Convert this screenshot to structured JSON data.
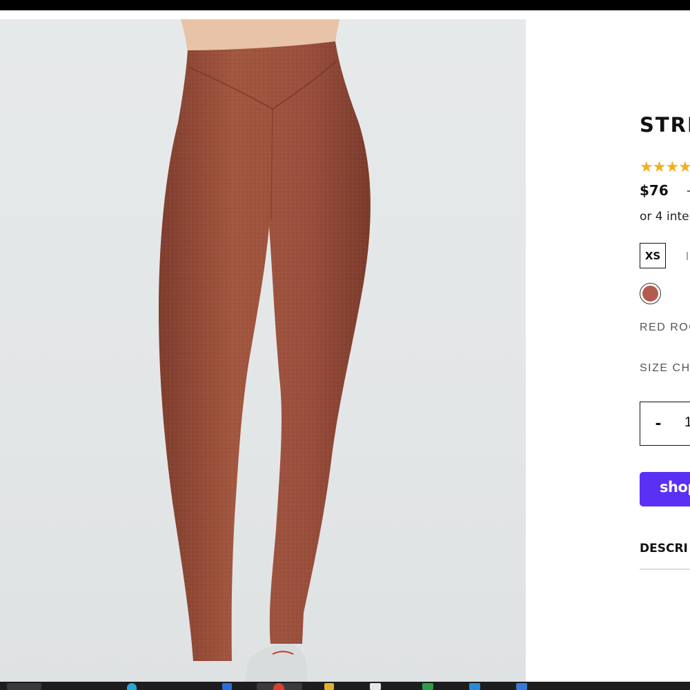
{
  "product": {
    "title": "STRE",
    "rating_stars": "★★★★",
    "price": "$76",
    "compare_price": "–",
    "installments_text": "or 4 inte",
    "image_alt": "",
    "sizes": [
      {
        "label": "XS",
        "selected": true
      },
      {
        "label": "",
        "selected": false
      }
    ],
    "color": {
      "name": "RED ROC",
      "swatch_hex": "#b55a4f"
    },
    "size_chart_label": "SIZE CH",
    "quantity": {
      "minus_label": "-",
      "value": "1"
    },
    "shop_pay_label": "shop",
    "description_tab_label": "DESCRI"
  },
  "colors": {
    "accent_shop_pay": "#5a31f4",
    "star": "#f2b01e",
    "legging": "#9a4f3d",
    "background_image": "#e3e6e7"
  },
  "taskbar": {
    "icons": [
      "search-icon",
      "chrome-icon",
      "app-icon",
      "app-icon",
      "app-icon",
      "app-icon"
    ]
  }
}
